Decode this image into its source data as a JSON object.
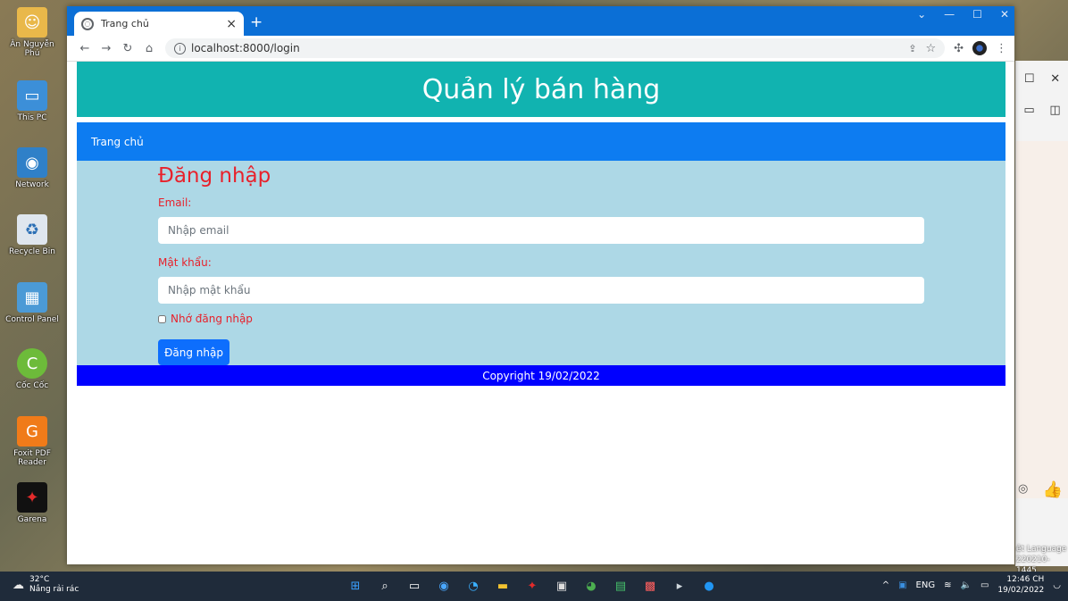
{
  "desktop": {
    "icons": [
      {
        "label": "Ân Nguyễn Phú"
      },
      {
        "label": "This PC"
      },
      {
        "label": "Network"
      },
      {
        "label": "Recycle Bin"
      },
      {
        "label": "Control Panel"
      },
      {
        "label": "Cốc Cốc"
      },
      {
        "label": "Foxit PDF Reader"
      },
      {
        "label": "Garena"
      }
    ],
    "right_window_lang": "ệt Language",
    "right_window_build": "220210-1445"
  },
  "browser": {
    "tab_title": "Trang chủ",
    "url": "localhost:8000/login"
  },
  "page": {
    "header_title": "Quản lý bán hàng",
    "nav_home": "Trang chủ",
    "login_title": "Đăng nhập",
    "email_label": "Email:",
    "email_placeholder": "Nhập email",
    "password_label": "Mật khẩu:",
    "password_placeholder": "Nhập mật khẩu",
    "remember_label": "Nhớ đăng nhập",
    "submit_label": "Đăng nhập",
    "footer_text": "Copyright 19/02/2022"
  },
  "taskbar": {
    "temperature": "32°C",
    "weather_text": "Nắng rải rác",
    "language": "ENG",
    "time": "12:46 CH",
    "date": "19/02/2022"
  },
  "colors": {
    "header_bg": "#11b3b0",
    "nav_bg": "#0d7cf1",
    "content_bg": "#add8e6",
    "footer_bg": "#0000ff",
    "label_red": "#e8212b",
    "button_blue": "#0d6efd"
  }
}
